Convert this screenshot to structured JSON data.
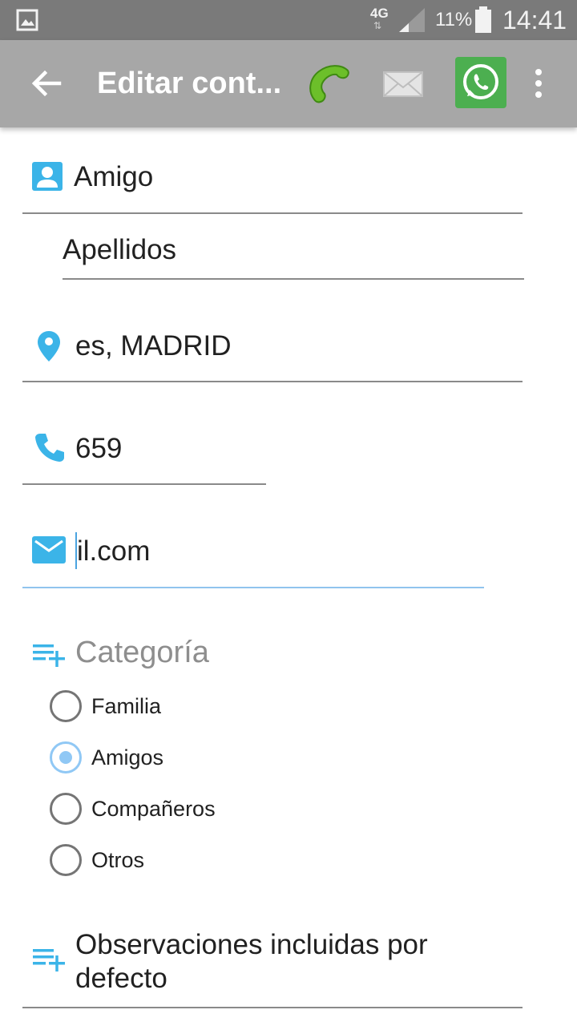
{
  "status_bar": {
    "network": "4G",
    "battery": "11%",
    "time": "14:41"
  },
  "app_bar": {
    "title": "Editar cont..."
  },
  "form": {
    "name": "Amigo",
    "surname": "Apellidos",
    "address": "es, MADRID",
    "phone": "659",
    "email": "il.com"
  },
  "category": {
    "title": "Categoría",
    "options": [
      {
        "label": "Familia",
        "checked": false
      },
      {
        "label": "Amigos",
        "checked": true
      },
      {
        "label": "Compañeros",
        "checked": false
      },
      {
        "label": "Otros",
        "checked": false
      }
    ]
  },
  "observations": {
    "text": "Observaciones incluidas por defecto"
  },
  "colors": {
    "accent": "#3bb4e8",
    "app_bar": "#a7a7a7",
    "status_bar": "#7a7a7a",
    "whatsapp": "#4caf50",
    "radio_checked": "#90c8f5"
  }
}
